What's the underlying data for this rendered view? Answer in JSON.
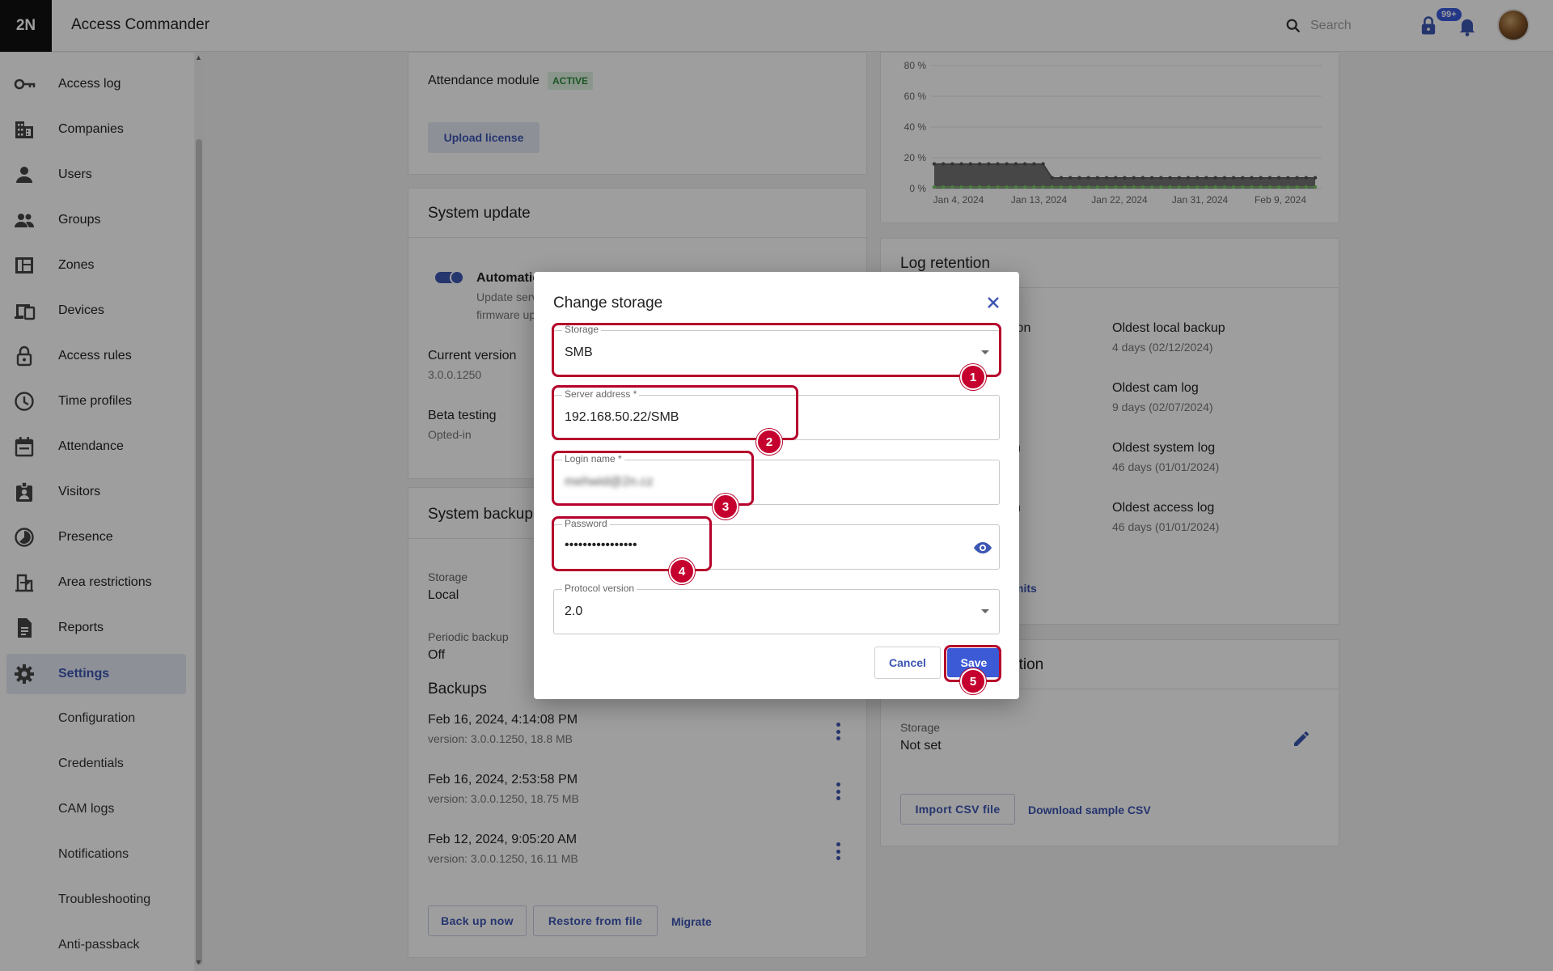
{
  "app": {
    "logo": "2N",
    "title": "Access Commander"
  },
  "topbar": {
    "search_placeholder": "Search",
    "notification_badge": "99+"
  },
  "sidebar": {
    "items": [
      {
        "label": "Access log",
        "icon": "key-icon"
      },
      {
        "label": "Companies",
        "icon": "building-icon"
      },
      {
        "label": "Users",
        "icon": "person-icon"
      },
      {
        "label": "Groups",
        "icon": "people-icon"
      },
      {
        "label": "Zones",
        "icon": "dashboard-icon"
      },
      {
        "label": "Devices",
        "icon": "devices-icon"
      },
      {
        "label": "Access rules",
        "icon": "lock-icon"
      },
      {
        "label": "Time profiles",
        "icon": "clock-icon"
      },
      {
        "label": "Attendance",
        "icon": "calendar-icon"
      },
      {
        "label": "Visitors",
        "icon": "badge-icon"
      },
      {
        "label": "Presence",
        "icon": "presence-icon"
      },
      {
        "label": "Area restrictions",
        "icon": "area-icon"
      },
      {
        "label": "Reports",
        "icon": "report-icon"
      },
      {
        "label": "Settings",
        "icon": "gear-icon",
        "active": true
      }
    ],
    "sub_items": [
      "Configuration",
      "Credentials",
      "CAM logs",
      "Notifications",
      "Troubleshooting",
      "Anti-passback"
    ]
  },
  "license_card": {
    "module_label": "Attendance module",
    "module_status": "ACTIVE",
    "upload_button": "Upload license"
  },
  "system_update": {
    "title": "System update",
    "toggle_label": "Automatic",
    "toggle_desc_line1": "Update serv",
    "toggle_desc_line2": "firmware up",
    "current_version_label": "Current version",
    "current_version": "3.0.0.1250",
    "beta_label": "Beta testing",
    "beta_value": "Opted-in"
  },
  "system_backup": {
    "title": "System backup",
    "storage_label": "Storage",
    "storage_value": "Local",
    "periodic_label": "Periodic backup",
    "periodic_value": "Off",
    "backups_heading": "Backups",
    "backups": [
      {
        "date": "Feb 16, 2024, 4:14:08 PM",
        "meta": "version: 3.0.0.1250, 18.8 MB"
      },
      {
        "date": "Feb 16, 2024, 2:53:58 PM",
        "meta": "version: 3.0.0.1250, 18.75 MB"
      },
      {
        "date": "Feb 12, 2024, 9:05:20 AM",
        "meta": "version: 3.0.0.1250, 16.11 MB"
      }
    ],
    "buttons": {
      "backup_now": "Back up now",
      "restore": "Restore from file",
      "migrate": "Migrate"
    }
  },
  "chart_data": {
    "type": "area",
    "y_ticks": [
      "80 %",
      "60 %",
      "40 %",
      "20 %",
      "0 %"
    ],
    "ylim": [
      0,
      80
    ],
    "x_ticks": [
      "Jan 4, 2024",
      "Jan 13, 2024",
      "Jan 22, 2024",
      "Jan 31, 2024",
      "Feb 9, 2024"
    ],
    "series": [
      {
        "values": [
          16,
          16,
          16,
          16,
          16,
          16,
          16,
          16,
          16,
          16,
          16,
          16,
          16,
          7,
          7,
          7,
          7,
          7,
          7,
          7,
          7,
          7,
          7,
          7,
          7,
          7,
          7,
          7,
          7,
          7,
          7,
          7,
          7,
          7,
          7,
          7,
          7,
          7,
          7,
          7,
          7,
          7,
          7
        ],
        "color": "#555555"
      },
      {
        "values": [
          1,
          1,
          1,
          1,
          1,
          1,
          1,
          1,
          1,
          1,
          1,
          1,
          1,
          1,
          1,
          1,
          1,
          1,
          1,
          1,
          1,
          1,
          1,
          1,
          1,
          1,
          1,
          1,
          1,
          1,
          1,
          1,
          1,
          1,
          1,
          1,
          1,
          1,
          1,
          1,
          1,
          1,
          1
        ],
        "color": "#7ac46a"
      }
    ]
  },
  "log_retention": {
    "title": "Log retention",
    "left_partials": [
      "ion",
      "n",
      "n"
    ],
    "entries": [
      {
        "label": "Oldest local backup",
        "value": "4 days (02/12/2024)"
      },
      {
        "label": "Oldest cam log",
        "value": "9 days (02/07/2024)"
      },
      {
        "label": "Oldest system log",
        "value": "46 days (01/01/2024)"
      },
      {
        "label": "Oldest access log",
        "value": "46 days (01/01/2024)"
      }
    ],
    "link_partial": "mits"
  },
  "import_card": {
    "title_partial": "ation",
    "storage_label": "Storage",
    "storage_value": "Not set",
    "import_button": "Import CSV file",
    "download_link": "Download sample CSV"
  },
  "dialog": {
    "title": "Change storage",
    "storage_label": "Storage",
    "storage_value": "SMB",
    "server_label": "Server address *",
    "server_value": "192.168.50.22/SMB",
    "login_label": "Login name *",
    "login_value": "mehwid@2n.cz",
    "password_label": "Password",
    "password_value": "••••••••••••••••",
    "protocol_label": "Protocol version",
    "protocol_value": "2.0",
    "cancel": "Cancel",
    "save": "Save"
  },
  "annotations": [
    "1",
    "2",
    "3",
    "4",
    "5"
  ],
  "colors": {
    "accent": "#3d56b2",
    "annotation": "#b5002b",
    "active_tag": "#2e8b3c"
  }
}
